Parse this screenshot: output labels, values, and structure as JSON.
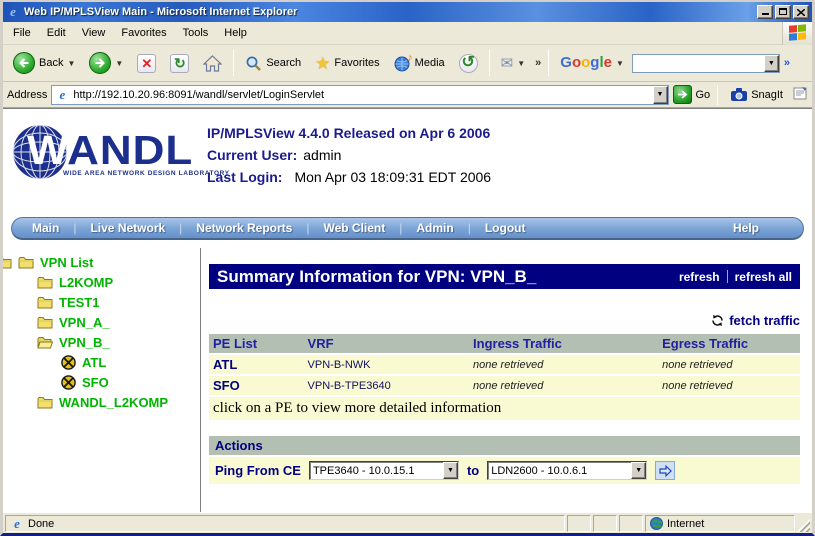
{
  "window": {
    "title": "Web IP/MPLSView Main - Microsoft Internet Explorer",
    "menu": [
      "File",
      "Edit",
      "View",
      "Favorites",
      "Tools",
      "Help"
    ],
    "toolbar": {
      "back": "Back",
      "search": "Search",
      "favorites": "Favorites",
      "media": "Media",
      "overflow": "»",
      "google": "Google",
      "google_input_value": ""
    },
    "address": {
      "label": "Address",
      "url": "http://192.10.20.96:8091/wandl/servlet/LoginServlet",
      "go": "Go",
      "snagit": "SnagIt"
    },
    "status": {
      "left": "Done",
      "right": "Internet"
    }
  },
  "page": {
    "header": {
      "logo_text": "WANDL",
      "logo_tagline": "WIDE AREA NETWORK DESIGN LABORATORY",
      "title": "IP/MPLSView 4.4.0 Released on Apr 6 2006",
      "current_user_label": "Current User:",
      "current_user": "admin",
      "last_login_label": "Last Login:",
      "last_login": "Mon Apr 03 18:09:31 EDT 2006"
    },
    "nav": {
      "items": [
        "Main",
        "Live Network",
        "Network Reports",
        "Web Client",
        "Admin",
        "Logout"
      ],
      "help": "Help"
    },
    "tree": {
      "root": "VPN List",
      "items": [
        {
          "label": "L2KOMP",
          "type": "folder",
          "level": 1
        },
        {
          "label": "TEST1",
          "type": "folder",
          "level": 1
        },
        {
          "label": "VPN_A_",
          "type": "folder",
          "level": 1
        },
        {
          "label": "VPN_B_",
          "type": "folder-open",
          "level": 1
        },
        {
          "label": "ATL",
          "type": "router",
          "level": 2
        },
        {
          "label": "SFO",
          "type": "router",
          "level": 2
        },
        {
          "label": "WANDL_L2KOMP",
          "type": "folder",
          "level": 1
        }
      ]
    },
    "main": {
      "title": "Summary Information for VPN: VPN_B_",
      "refresh": "refresh",
      "refresh_all": "refresh all",
      "fetch_traffic": "fetch traffic",
      "table": {
        "headers": [
          "PE List",
          "VRF",
          "Ingress Traffic",
          "Egress Traffic"
        ],
        "rows": [
          [
            "ATL",
            "VPN-B-NWK",
            "none retrieved",
            "none retrieved"
          ],
          [
            "SFO",
            "VPN-B-TPE3640",
            "none retrieved",
            "none retrieved"
          ]
        ],
        "note": "click on a PE to view more detailed information"
      },
      "actions": {
        "title": "Actions",
        "ping_label": "Ping From CE",
        "from_value": "TPE3640 - 10.0.15.1",
        "to_label": "to",
        "to_value": "LDN2600 - 10.0.6.1"
      }
    }
  },
  "colors": {
    "navy_header": "#000080",
    "table_header_bg": "#b4bfb4",
    "row_bg": "#fafad2",
    "tree_green": "#00b400",
    "nav_blue": "#7aa2d6"
  }
}
